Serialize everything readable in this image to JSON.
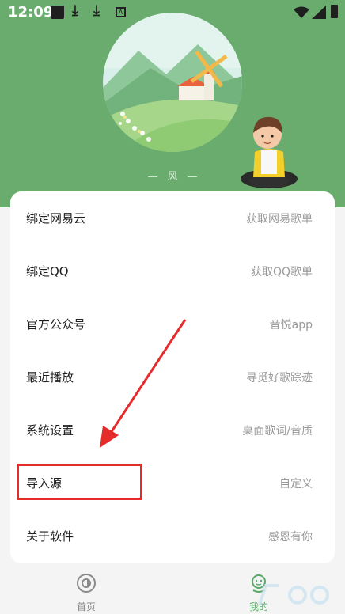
{
  "status_bar": {
    "time": "12:09"
  },
  "profile": {
    "name": "风"
  },
  "menu": [
    {
      "label": "绑定网易云",
      "sub": "获取网易歌单"
    },
    {
      "label": "绑定QQ",
      "sub": "获取QQ歌单"
    },
    {
      "label": "官方公众号",
      "sub": "音悦app"
    },
    {
      "label": "最近播放",
      "sub": "寻觅好歌踪迹"
    },
    {
      "label": "系统设置",
      "sub": "桌面歌词/音质"
    },
    {
      "label": "导入源",
      "sub": "自定义"
    },
    {
      "label": "关于软件",
      "sub": "感恩有你"
    }
  ],
  "tabs": [
    {
      "label": "首页",
      "icon": "music-disc-icon"
    },
    {
      "label": "我的",
      "icon": "smiley-icon"
    }
  ],
  "colors": {
    "header_green": "#69ac6e",
    "annotation_red": "#e62b2b",
    "active_tab": "#5aa96a"
  }
}
